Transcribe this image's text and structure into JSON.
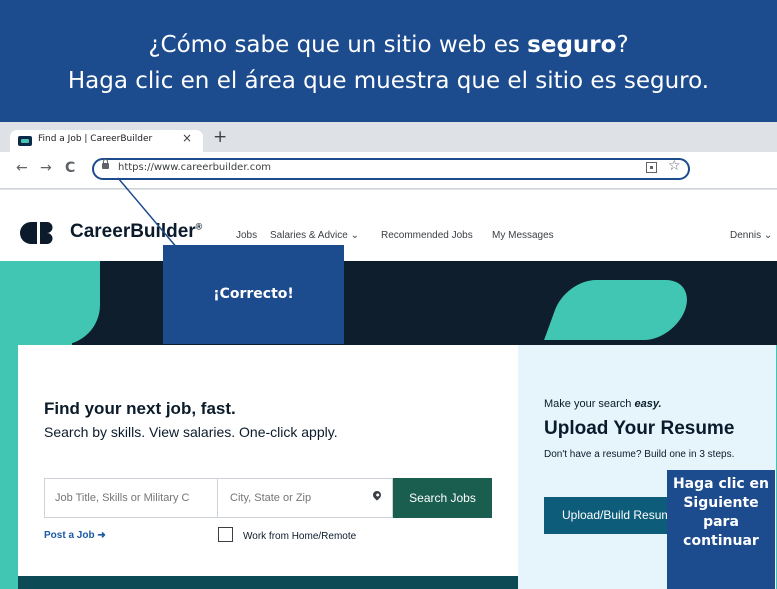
{
  "instruction": {
    "line1_pre": "¿Cómo sabe que un sitio web es ",
    "line1_bold": "seguro",
    "line1_post": "?",
    "line2": "Haga clic en el área que muestra que el sitio es seguro."
  },
  "browser": {
    "tab_title": "Find a Job | CareerBuilder",
    "tab_close": "×",
    "new_tab": "+",
    "back": "←",
    "forward": "→",
    "reload": "C",
    "url": "https://www.careerbuilder.com",
    "star": "☆"
  },
  "site": {
    "brand": "CareerBuilder",
    "brand_mark": "®",
    "nav": [
      {
        "label": "Jobs"
      },
      {
        "label": "Salaries & Advice ⌄"
      },
      {
        "label": "Recommended Jobs"
      },
      {
        "label": "My Messages"
      }
    ],
    "user": "Dennis ⌄"
  },
  "search": {
    "headline": "Find your next job, fast.",
    "subheadline": "Search by skills. View salaries. One-click apply.",
    "job_placeholder": "Job Title, Skills or Military C",
    "location_placeholder": "City, State or Zip",
    "button": "Search Jobs",
    "post_job": "Post a Job ➜",
    "remote_label": "Work from Home/Remote"
  },
  "resume": {
    "make_easy_pre": "Make your search ",
    "make_easy_em": "easy.",
    "title": "Upload Your Resume",
    "sub": "Don't have a resume? Build one in 3 steps.",
    "button": "Upload/Build Resume"
  },
  "tutorial": {
    "correct": "¡Correcto!",
    "next_hint": "Haga clic en Siguiente para continuar"
  },
  "colors": {
    "banner": "#1c4b8e",
    "hero_teal": "#40c6b3",
    "hero_dark": "#0f1e2d",
    "search_button": "#1a5e4f",
    "upload_button": "#0c5c7a"
  }
}
